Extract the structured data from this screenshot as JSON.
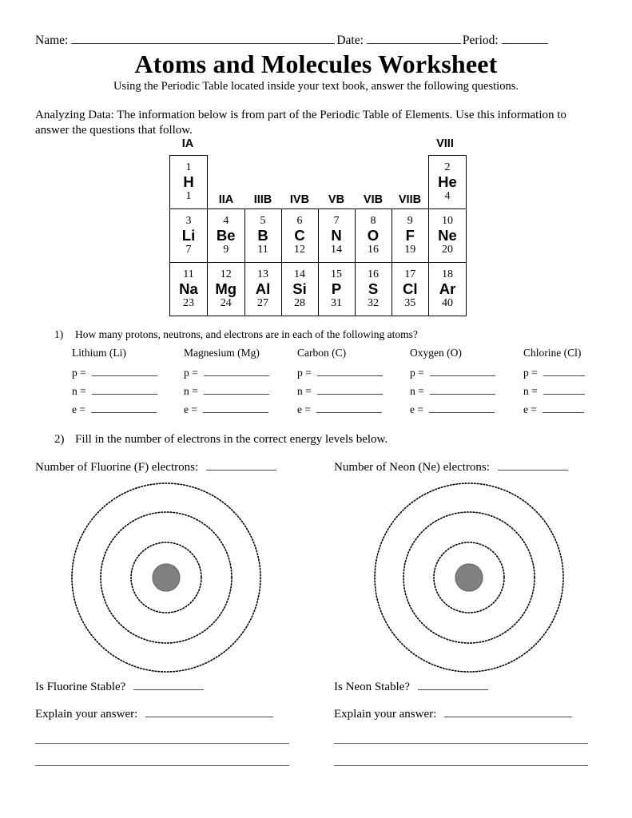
{
  "header": {
    "name_label": "Name:",
    "date_label": "Date:",
    "period_label": "Period:"
  },
  "title": "Atoms and Molecules Worksheet",
  "subtitle": "Using the Periodic Table located inside your text book, answer the following questions.",
  "intro": "Analyzing Data: The information below is from part of the Periodic Table of Elements. Use this information to answer the questions that follow.",
  "periodic_table": {
    "group_labels_top": {
      "ia": "IA",
      "viii": "VIII"
    },
    "group_labels_inline": [
      "IIA",
      "IIIB",
      "IVB",
      "VB",
      "VIB",
      "VIIB"
    ],
    "row1": {
      "hydrogen": {
        "number": "1",
        "symbol": "H",
        "mass": "1"
      },
      "helium": {
        "number": "2",
        "symbol": "He",
        "mass": "4"
      }
    },
    "row2": [
      {
        "number": "3",
        "symbol": "Li",
        "mass": "7"
      },
      {
        "number": "4",
        "symbol": "Be",
        "mass": "9"
      },
      {
        "number": "5",
        "symbol": "B",
        "mass": "11"
      },
      {
        "number": "6",
        "symbol": "C",
        "mass": "12"
      },
      {
        "number": "7",
        "symbol": "N",
        "mass": "14"
      },
      {
        "number": "8",
        "symbol": "O",
        "mass": "16"
      },
      {
        "number": "9",
        "symbol": "F",
        "mass": "19"
      },
      {
        "number": "10",
        "symbol": "Ne",
        "mass": "20"
      }
    ],
    "row3": [
      {
        "number": "11",
        "symbol": "Na",
        "mass": "23"
      },
      {
        "number": "12",
        "symbol": "Mg",
        "mass": "24"
      },
      {
        "number": "13",
        "symbol": "Al",
        "mass": "27"
      },
      {
        "number": "14",
        "symbol": "Si",
        "mass": "28"
      },
      {
        "number": "15",
        "symbol": "P",
        "mass": "31"
      },
      {
        "number": "16",
        "symbol": "S",
        "mass": "32"
      },
      {
        "number": "17",
        "symbol": "Cl",
        "mass": "35"
      },
      {
        "number": "18",
        "symbol": "Ar",
        "mass": "40"
      }
    ]
  },
  "question1": {
    "number": "1)",
    "text": "How many protons, neutrons, and electrons are in each of the following atoms?",
    "columns": [
      {
        "element": "Lithium (Li)",
        "p_label": "p =",
        "n_label": "n =",
        "e_label": "e ="
      },
      {
        "element": "Magnesium (Mg)",
        "p_label": "p =",
        "n_label": "n =",
        "e_label": "e ="
      },
      {
        "element": "Carbon (C)",
        "p_label": "p =",
        "n_label": "n =",
        "e_label": "e ="
      },
      {
        "element": "Oxygen (O)",
        "p_label": "p =",
        "n_label": "n =",
        "e_label": "e ="
      },
      {
        "element": "Chlorine (Cl)",
        "p_label": "p =",
        "n_label": "n =",
        "e_label": "e ="
      }
    ]
  },
  "question2": {
    "number": "2)",
    "text": "Fill in the number of electrons in the correct energy levels below.",
    "left": {
      "electron_count_label": "Number of Fluorine (F) electrons:",
      "stable_label": "Is Fluorine Stable?",
      "explain_label": "Explain your answer:"
    },
    "right": {
      "electron_count_label": "Number of Neon (Ne) electrons:",
      "stable_label": "Is Neon Stable?",
      "explain_label": "Explain your answer:"
    }
  },
  "atom_diagram": {
    "shell_count": 3,
    "nucleus_color": "#808080",
    "shell_style": "dotted",
    "shell_color": "#000000"
  },
  "colors": {
    "text": "#000000",
    "rule": "#444444",
    "table_border": "#000000",
    "nucleus": "#808080"
  }
}
